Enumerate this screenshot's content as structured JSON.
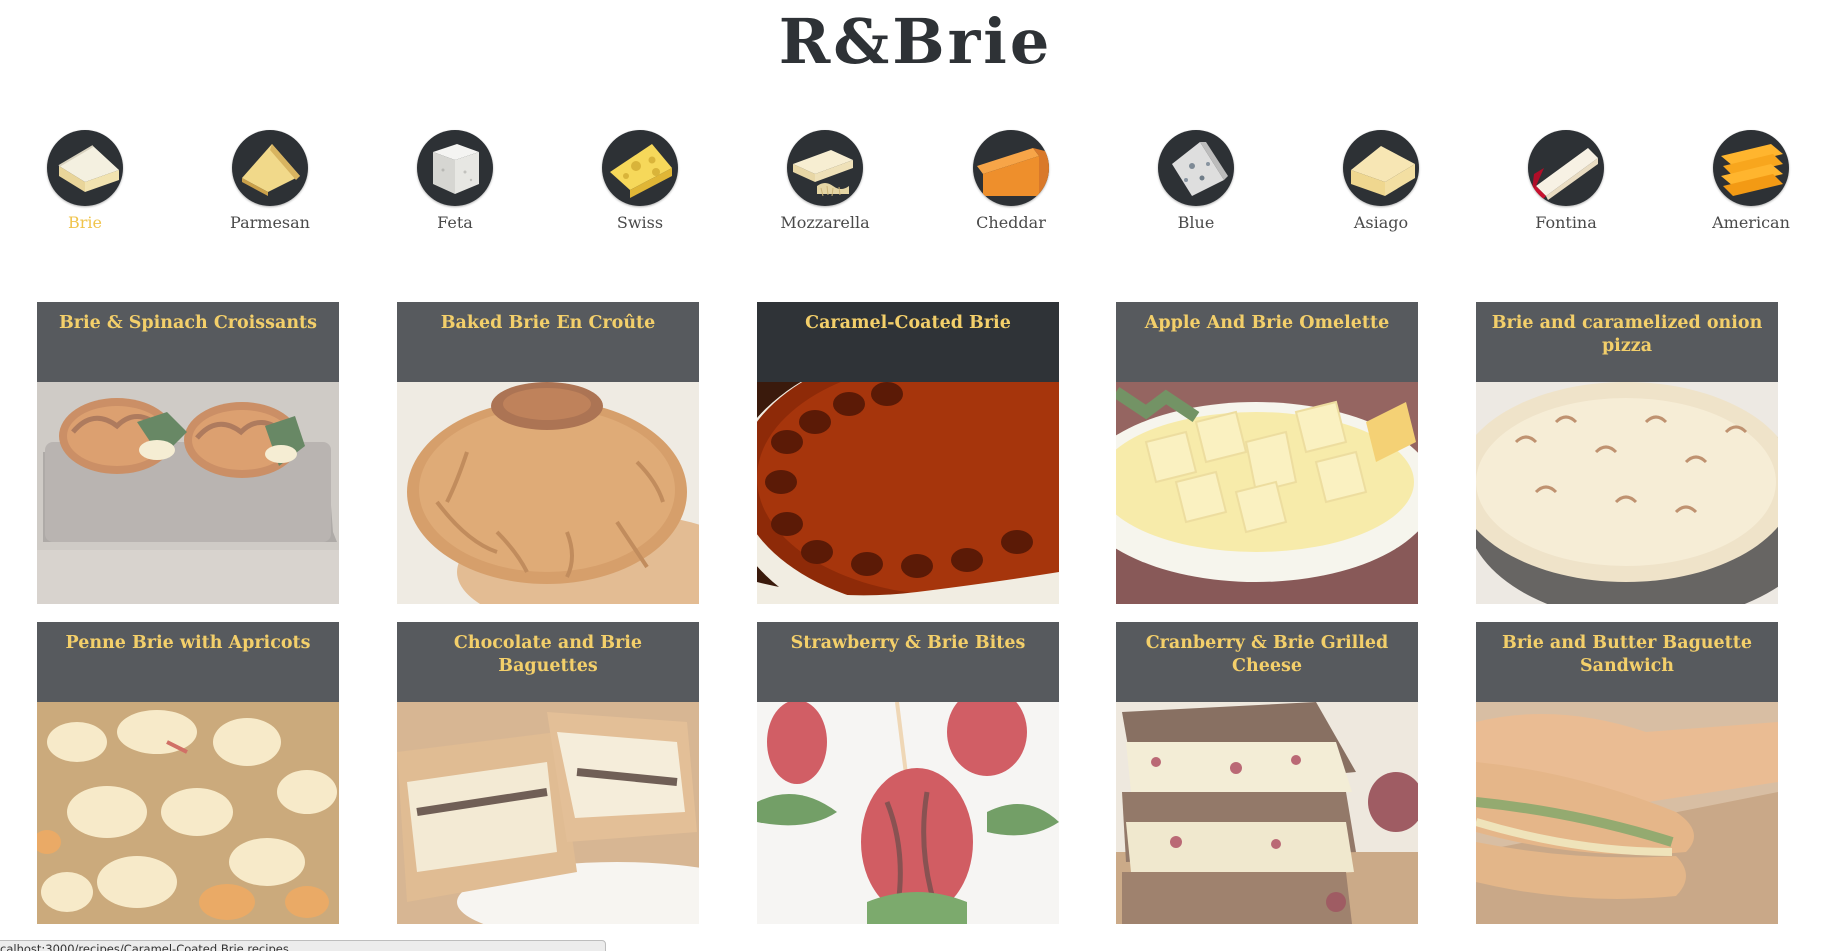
{
  "site": {
    "logo": "R&Brie"
  },
  "cheeses": [
    {
      "label": "Brie",
      "active": true,
      "icon": "brie-cheese-icon"
    },
    {
      "label": "Parmesan",
      "active": false,
      "icon": "parmesan-cheese-icon"
    },
    {
      "label": "Feta",
      "active": false,
      "icon": "feta-cheese-icon"
    },
    {
      "label": "Swiss",
      "active": false,
      "icon": "swiss-cheese-icon"
    },
    {
      "label": "Mozzarella",
      "active": false,
      "icon": "mozzarella-cheese-icon"
    },
    {
      "label": "Cheddar",
      "active": false,
      "icon": "cheddar-cheese-icon"
    },
    {
      "label": "Blue",
      "active": false,
      "icon": "blue-cheese-icon"
    },
    {
      "label": "Asiago",
      "active": false,
      "icon": "asiago-cheese-icon"
    },
    {
      "label": "Fontina",
      "active": false,
      "icon": "fontina-cheese-icon"
    },
    {
      "label": "American",
      "active": false,
      "icon": "american-cheese-icon"
    }
  ],
  "recipes": [
    {
      "title": "Brie & Spinach Croissants",
      "image": "croissant-photo",
      "hovered": false
    },
    {
      "title": "Baked Brie En Croûte",
      "image": "baked-brie-photo",
      "hovered": false
    },
    {
      "title": "Caramel-Coated Brie",
      "image": "caramel-brie-photo",
      "hovered": true
    },
    {
      "title": "Apple And Brie Omelette",
      "image": "omelette-photo",
      "hovered": false
    },
    {
      "title": "Brie and caramelized onion pizza",
      "image": "pizza-photo",
      "hovered": false
    },
    {
      "title": "Penne Brie with Apricots",
      "image": "penne-photo",
      "hovered": false
    },
    {
      "title": "Chocolate and Brie Baguettes",
      "image": "chocolate-baguette-photo",
      "hovered": false
    },
    {
      "title": "Strawberry & Brie Bites",
      "image": "strawberry-photo",
      "hovered": false
    },
    {
      "title": "Cranberry & Brie Grilled Cheese",
      "image": "grilled-cheese-photo",
      "hovered": false
    },
    {
      "title": "Brie and Butter Baguette Sandwich",
      "image": "baguette-sandwich-photo",
      "hovered": false
    }
  ],
  "status_bar": {
    "url": "calhost:3000/recipes/Caramel-Coated Brie recipes"
  },
  "colors": {
    "accent": "#f0c44c",
    "card_header": "#575a5e",
    "card_header_hover": "#2f3337",
    "card_title": "#f3cf6a",
    "logo": "#2e3236"
  }
}
